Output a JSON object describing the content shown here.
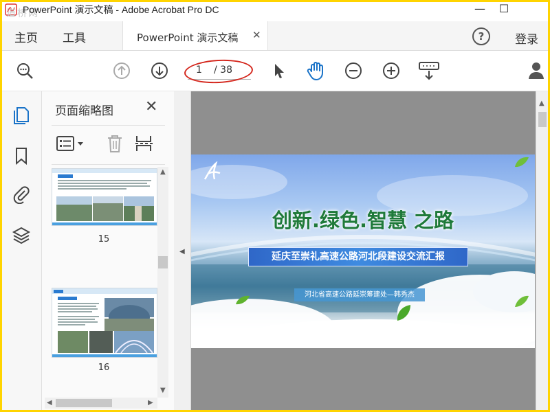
{
  "window": {
    "title": "PowerPoint 演示文稿 - Adobe Acrobat Pro DC",
    "watermark": "道桥网",
    "minimize": "—",
    "maximize": "☐"
  },
  "tabs": {
    "home": "主页",
    "tools": "工具",
    "document": "PowerPoint 演示文稿",
    "close_symbol": "✕",
    "help_symbol": "?",
    "login": "登录"
  },
  "toolbar": {
    "current_page": "1",
    "total_pages": "/ 38",
    "icons": [
      "search-icon",
      "page-up-icon",
      "page-down-icon",
      "select-cursor-icon",
      "hand-tool-icon",
      "zoom-out-icon",
      "zoom-in-icon",
      "keyboard-scroll-icon",
      "share-user-icon"
    ]
  },
  "panel": {
    "title": "页面缩略图",
    "close_symbol": "✕",
    "thumbnails": [
      {
        "label": "15"
      },
      {
        "label": "16"
      }
    ]
  },
  "slide": {
    "headline": "创新.绿色.智慧 之路",
    "subtitle": "延庆至崇礼高速公路河北段建设交流汇报",
    "author": "河北省高速公路延崇筹建处—韩秀杰"
  },
  "colors": {
    "accent": "#1a73c8",
    "frame": "#ffd400",
    "headline": "#1f7a3a",
    "ring": "#d4261c"
  }
}
